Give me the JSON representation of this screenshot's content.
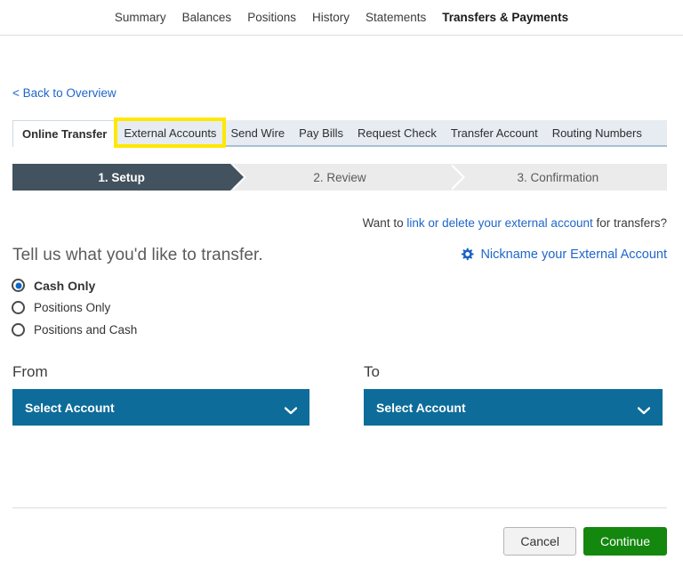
{
  "topnav": {
    "items": [
      {
        "label": "Summary",
        "active": false
      },
      {
        "label": "Balances",
        "active": false
      },
      {
        "label": "Positions",
        "active": false
      },
      {
        "label": "History",
        "active": false
      },
      {
        "label": "Statements",
        "active": false
      },
      {
        "label": "Transfers & Payments",
        "active": true
      }
    ]
  },
  "back_link": {
    "label": "< Back to Overview"
  },
  "tabs": {
    "items": [
      {
        "label": "Online Transfer",
        "active": true,
        "highlighted": false
      },
      {
        "label": "External Accounts",
        "active": false,
        "highlighted": true
      },
      {
        "label": "Send Wire",
        "active": false,
        "highlighted": false
      },
      {
        "label": "Pay Bills",
        "active": false,
        "highlighted": false
      },
      {
        "label": "Request Check",
        "active": false,
        "highlighted": false
      },
      {
        "label": "Transfer Account",
        "active": false,
        "highlighted": false
      },
      {
        "label": "Routing Numbers",
        "active": false,
        "highlighted": false
      }
    ],
    "highlight_color": "#ffe800"
  },
  "stepper": {
    "steps": [
      {
        "label": "1. Setup",
        "active": true
      },
      {
        "label": "2. Review",
        "active": false
      },
      {
        "label": "3. Confirmation",
        "active": false
      }
    ],
    "active_color": "#42525e",
    "inactive_color": "#ebebeb"
  },
  "info": {
    "want_prefix": "Want to ",
    "want_link": "link or delete your external account",
    "want_suffix": " for transfers?",
    "nickname_label": "Nickname your External Account",
    "nickname_icon": "gear-icon",
    "link_color": "#1f66c9"
  },
  "main": {
    "heading": "Tell us what you'd like to transfer.",
    "transfer_options": [
      {
        "label": "Cash Only",
        "selected": true
      },
      {
        "label": "Positions Only",
        "selected": false
      },
      {
        "label": "Positions and Cash",
        "selected": false
      }
    ],
    "from": {
      "label": "From",
      "value": "Select Account",
      "icon": "chevron-down-icon"
    },
    "to": {
      "label": "To",
      "value": "Select Account",
      "icon": "chevron-down-icon"
    },
    "select_color": "#0d6c99"
  },
  "footer": {
    "cancel_label": "Cancel",
    "continue_label": "Continue",
    "continue_color": "#14870e"
  }
}
